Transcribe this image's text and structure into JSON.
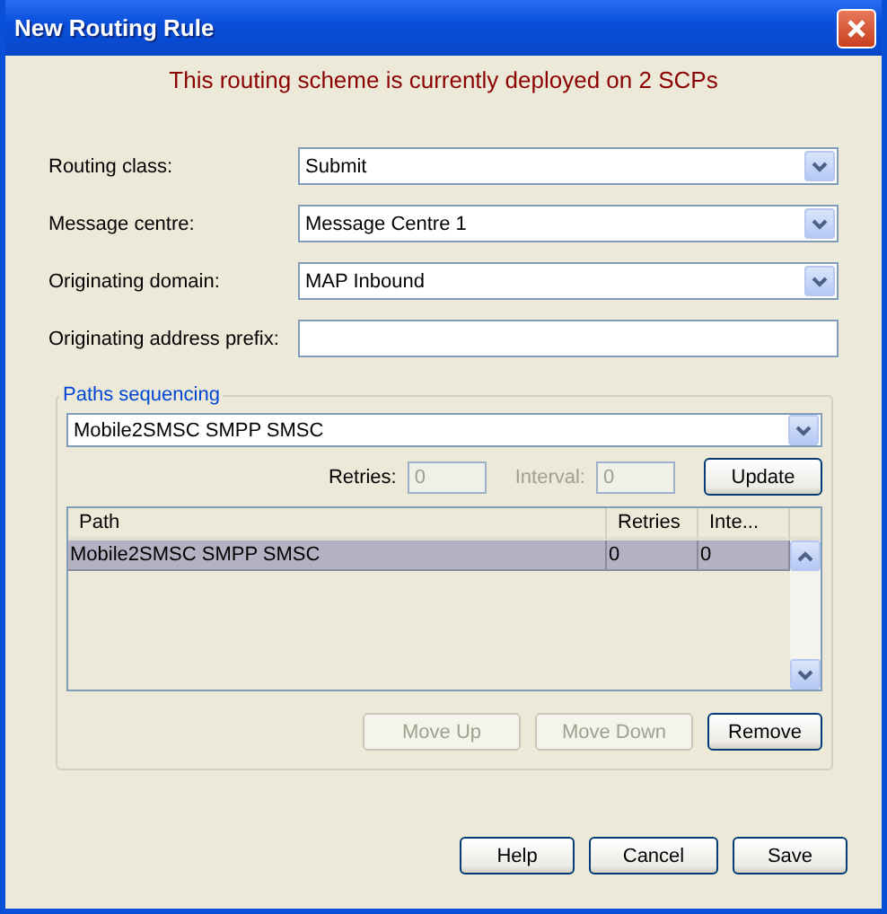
{
  "window": {
    "title": "New Routing Rule"
  },
  "notice": "This routing scheme is currently deployed on 2 SCPs",
  "fields": [
    {
      "label": "Routing class:",
      "kind": "select",
      "value": "Submit"
    },
    {
      "label": "Message centre:",
      "kind": "select",
      "value": "Message Centre 1"
    },
    {
      "label": "Originating domain:",
      "kind": "select",
      "value": "MAP Inbound"
    },
    {
      "label": "Originating address prefix:",
      "kind": "text"
    }
  ],
  "paths_sequencing": {
    "title": "Paths sequencing",
    "path_select": {
      "value": "Mobile2SMSC SMPP SMSC"
    },
    "inputs": [
      {
        "label": "Retries:",
        "value": "0",
        "disabled": true,
        "label_greyed": false
      },
      {
        "label": "Interval:",
        "value": "0",
        "disabled": true,
        "label_greyed": true
      }
    ],
    "update_button": {
      "label": "Update",
      "disabled": false
    },
    "table": {
      "columns": [
        "Path",
        "Retries",
        "Inte..."
      ],
      "rows": [
        {
          "cells": [
            "Mobile2SMSC SMPP SMSC",
            "0",
            "0"
          ],
          "selected": true
        }
      ]
    },
    "buttons": [
      {
        "label": "Move Up",
        "disabled": true
      },
      {
        "label": "Move Down",
        "disabled": true
      },
      {
        "label": "Remove",
        "disabled": false
      }
    ]
  },
  "buttons": [
    {
      "label": "Help",
      "disabled": false
    },
    {
      "label": "Cancel",
      "disabled": false
    },
    {
      "label": "Save",
      "disabled": false
    }
  ]
}
